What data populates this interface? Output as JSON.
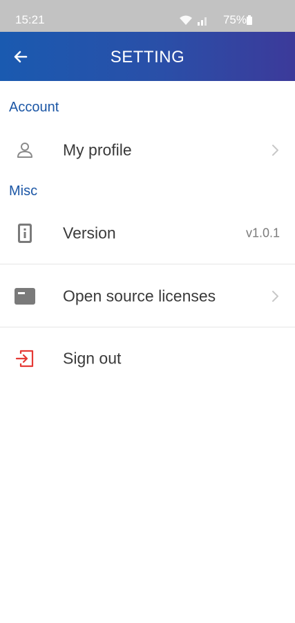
{
  "status_bar": {
    "time": "15:21",
    "battery": "75%",
    "icons": [
      "wifi-icon",
      "signal-icon",
      "battery-icon"
    ]
  },
  "app_bar": {
    "title": "SETTING",
    "back_icon": "arrow-left-icon"
  },
  "sections": {
    "account": {
      "title": "Account",
      "items": [
        {
          "label": "My profile",
          "icon": "person-icon",
          "trailing": "chevron-right-icon"
        }
      ]
    },
    "misc": {
      "title": "Misc",
      "items": [
        {
          "label": "Version",
          "icon": "info-card-icon",
          "value": "v1.0.1"
        },
        {
          "label": "Open source licenses",
          "icon": "license-card-icon",
          "trailing": "chevron-right-icon"
        },
        {
          "label": "Sign out",
          "icon": "sign-out-icon"
        }
      ]
    }
  },
  "colors": {
    "accent": "#1b56a5",
    "app_bar_start": "#1a5ab0",
    "app_bar_end": "#3c3a9a",
    "status_bar": "#c2c2c2",
    "sign_out_icon": "#e53935"
  }
}
